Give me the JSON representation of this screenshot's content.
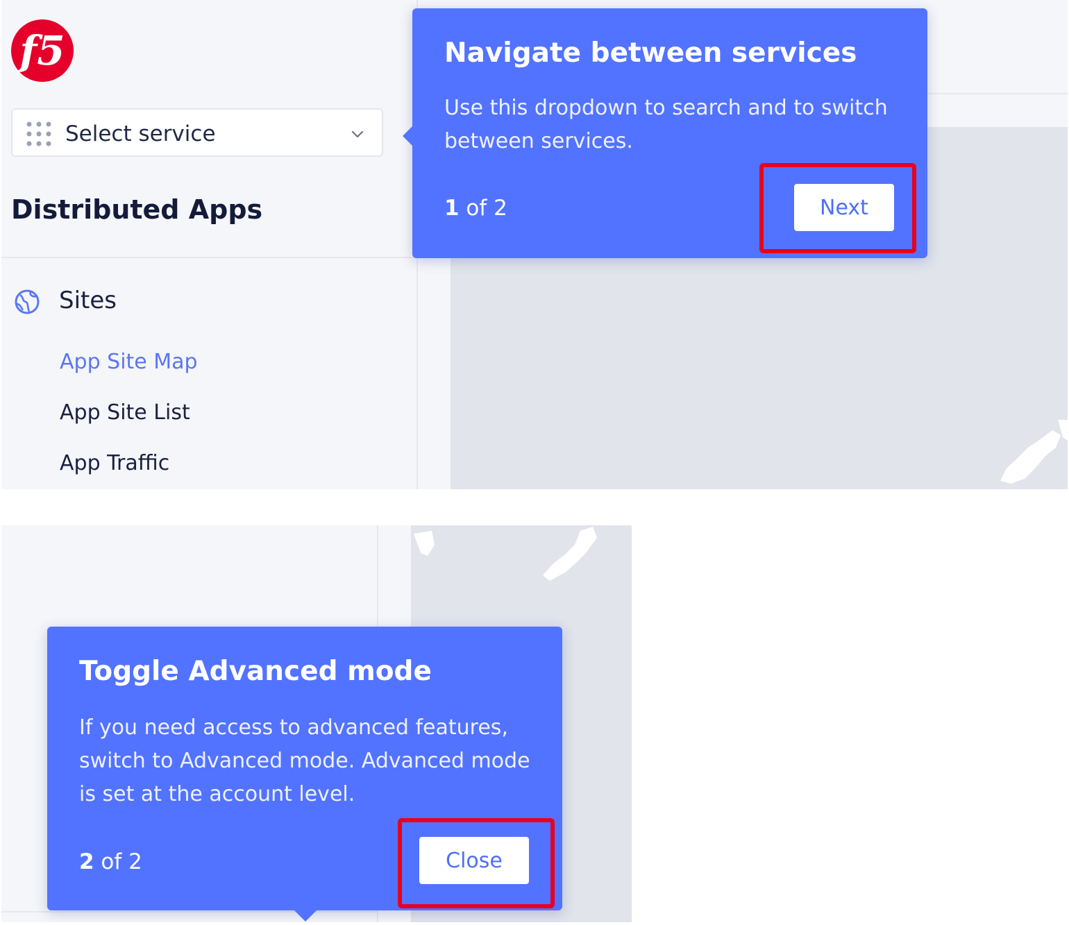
{
  "colors": {
    "accent": "#5273ff",
    "highlight": "#e8001e",
    "brand_red": "#e4002b",
    "active_link": "#5a76f5"
  },
  "top_panel": {
    "logo": {
      "text": "f5",
      "icon": "f5-logo"
    },
    "service_select": {
      "label": "Select service",
      "icon": "grid-dots-icon",
      "chevron": "chevron-down-icon"
    },
    "section_title": "Distributed Apps",
    "nav": {
      "group_label": "Sites",
      "group_icon": "globe-icon",
      "items": [
        {
          "label": "App Site Map",
          "active": true
        },
        {
          "label": "App Site List",
          "active": false
        },
        {
          "label": "App Traffic",
          "active": false
        }
      ]
    },
    "tooltip": {
      "title": "Navigate between services",
      "body": "Use this dropdown to search and to switch between services.",
      "step_current": "1",
      "step_rest": " of 2",
      "button_label": "Next"
    }
  },
  "bottom_panel": {
    "tooltip": {
      "title": "Toggle Advanced mode",
      "body": "If you need access to advanced features, switch to Advanced mode. Advanced mode is set at the account level.",
      "step_current": "2",
      "step_rest": " of 2",
      "button_label": "Close"
    }
  }
}
